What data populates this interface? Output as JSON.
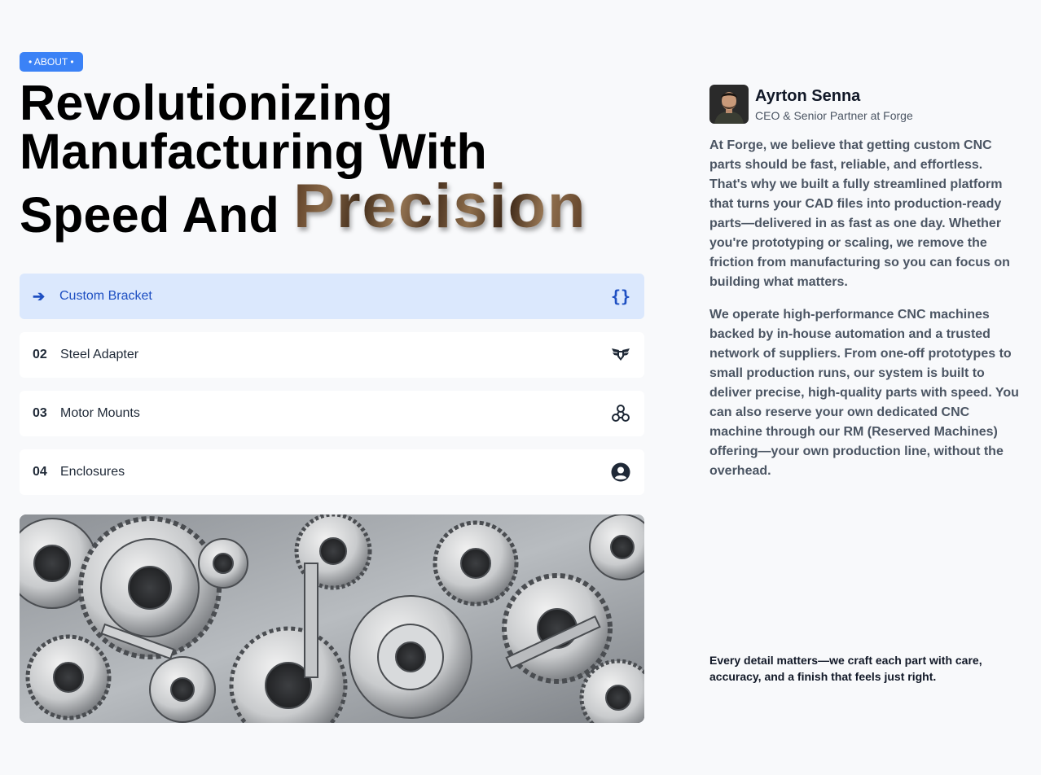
{
  "badge": "• ABOUT •",
  "headline": {
    "line1": "Revolutionizing",
    "line2": "Manufacturing With",
    "line3_prefix": "Speed And",
    "line3_highlight": "Precision"
  },
  "services": [
    {
      "num": "➔",
      "label": "Custom Bracket",
      "icon": "code-braces-icon",
      "active": true
    },
    {
      "num": "02",
      "label": "Steel Adapter",
      "icon": "winged-shield-icon",
      "active": false
    },
    {
      "num": "03",
      "label": "Motor Mounts",
      "icon": "nodes-icon",
      "active": false
    },
    {
      "num": "04",
      "label": "Enclosures",
      "icon": "user-circle-icon",
      "active": false
    }
  ],
  "profile": {
    "name": "Ayrton Senna",
    "role": "CEO & Senior Partner at Forge"
  },
  "paragraphs": [
    "At Forge, we believe that getting custom CNC parts should be fast, reliable, and effortless. That's why we built a fully streamlined platform that turns your CAD files into production-ready parts—delivered in as fast as one day. Whether you're prototyping or scaling, we remove the friction from manufacturing so you can focus on building what matters.",
    "We operate high-performance CNC machines backed by in-house automation and a trusted network of suppliers. From one-off prototypes to small production runs, our system is built to deliver precise, high-quality parts with speed. You can also reserve your own dedicated CNC machine through our RM (Reserved Machines) offering—your own production line, without the overhead."
  ],
  "tagline": "Every detail matters—we craft each part with care, accuracy, and a finish that feels just right.",
  "colors": {
    "accent": "#3b82f6",
    "active_bg": "#dbe8fd",
    "active_text": "#1e4fc2",
    "page_bg": "#f8f9fb"
  }
}
